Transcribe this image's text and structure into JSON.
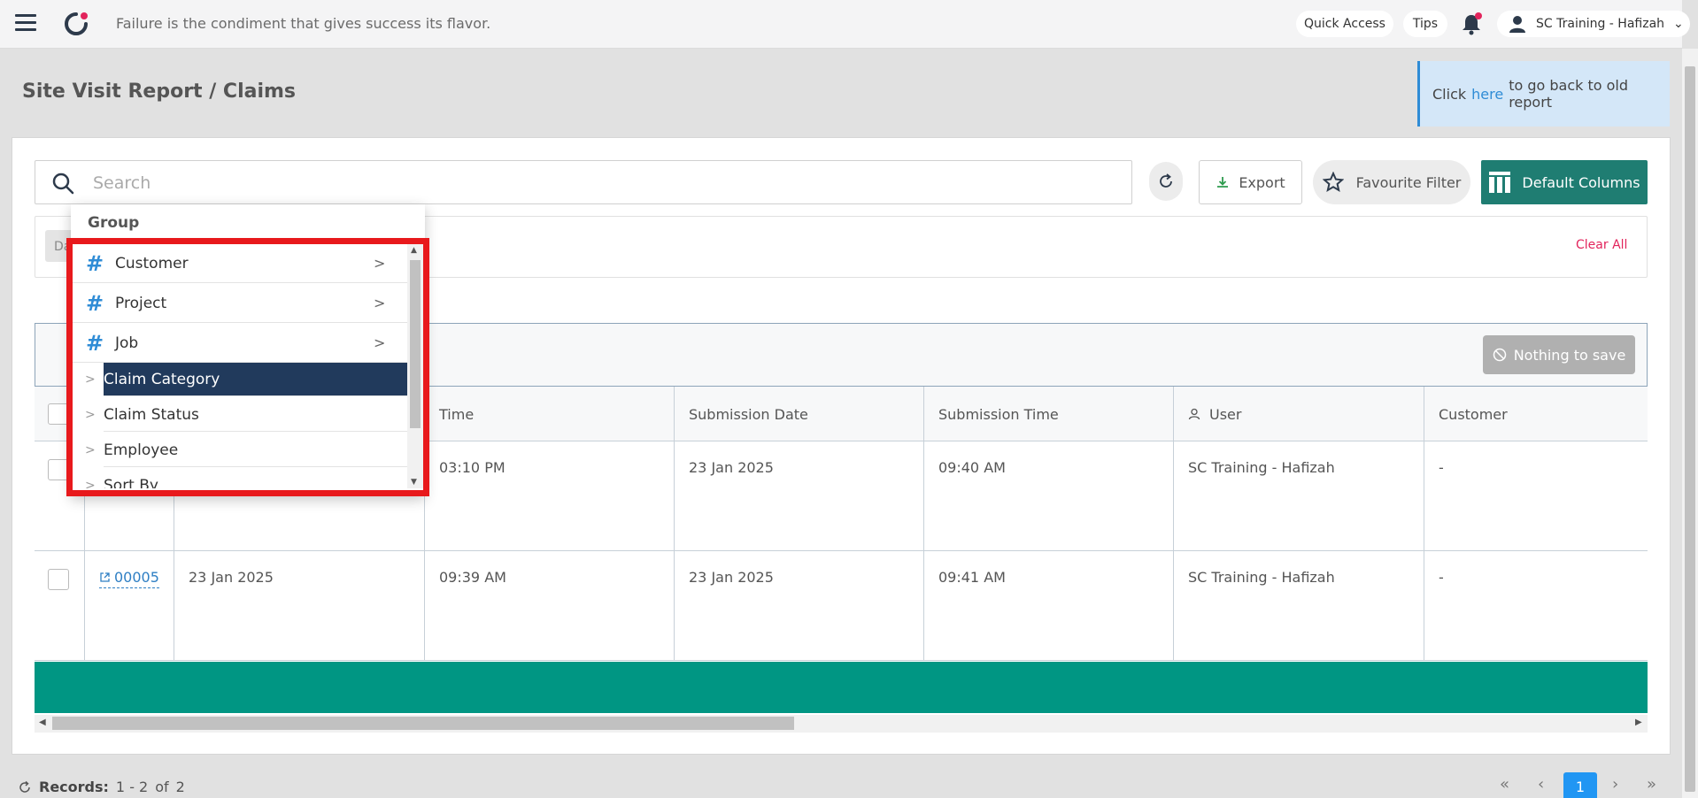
{
  "topbar": {
    "quote": "Failure is the condiment that gives success its flavor.",
    "quick_access": "Quick Access",
    "tips": "Tips",
    "user_name": "SC Training - Hafizah"
  },
  "page": {
    "title": "Site Visit Report / Claims",
    "old_report_prefix": "Click",
    "old_report_link": "here",
    "old_report_suffix": "to go back to old report"
  },
  "toolbar": {
    "search_placeholder": "Search",
    "export_label": "Export",
    "favourite_label": "Favourite Filter",
    "columns_label": "Default Columns"
  },
  "filters": {
    "chip_label": "Da",
    "clear_all": "Clear All"
  },
  "save_bar": {
    "nothing_to_save": "Nothing to save"
  },
  "group_menu": {
    "title": "Group",
    "items": [
      {
        "label": "Customer",
        "type": "field-group"
      },
      {
        "label": "Project",
        "type": "field-group"
      },
      {
        "label": "Job",
        "type": "field-group"
      },
      {
        "label": "Claim Category",
        "type": "field",
        "active": true
      },
      {
        "label": "Claim Status",
        "type": "field"
      },
      {
        "label": "Employee",
        "type": "field"
      },
      {
        "label": "Sort By",
        "type": "field"
      }
    ]
  },
  "table": {
    "headers": {
      "time": "Time",
      "submission_date": "Submission Date",
      "submission_time": "Submission Time",
      "user": "User",
      "customer": "Customer"
    },
    "rows": [
      {
        "id": "",
        "date": "",
        "time": "03:10 PM",
        "submission_date": "23 Jan 2025",
        "submission_time": "09:40 AM",
        "user": "SC Training - Hafizah",
        "customer": "-"
      },
      {
        "id": "00005",
        "date": "23 Jan 2025",
        "time": "09:39 AM",
        "submission_date": "23 Jan 2025",
        "submission_time": "09:41 AM",
        "user": "SC Training - Hafizah",
        "customer": "-"
      }
    ]
  },
  "footer": {
    "records_label": "Records:",
    "records_range": "1 - 2",
    "records_of": "of",
    "records_total": "2",
    "current_page": "1"
  },
  "colors": {
    "brand_teal": "#1f7d72",
    "green_bar": "#009683",
    "accent_blue": "#2f8cd6",
    "active_item": "#213a5c",
    "highlight_frame": "#e8191c",
    "clear_all": "#e2245c"
  }
}
